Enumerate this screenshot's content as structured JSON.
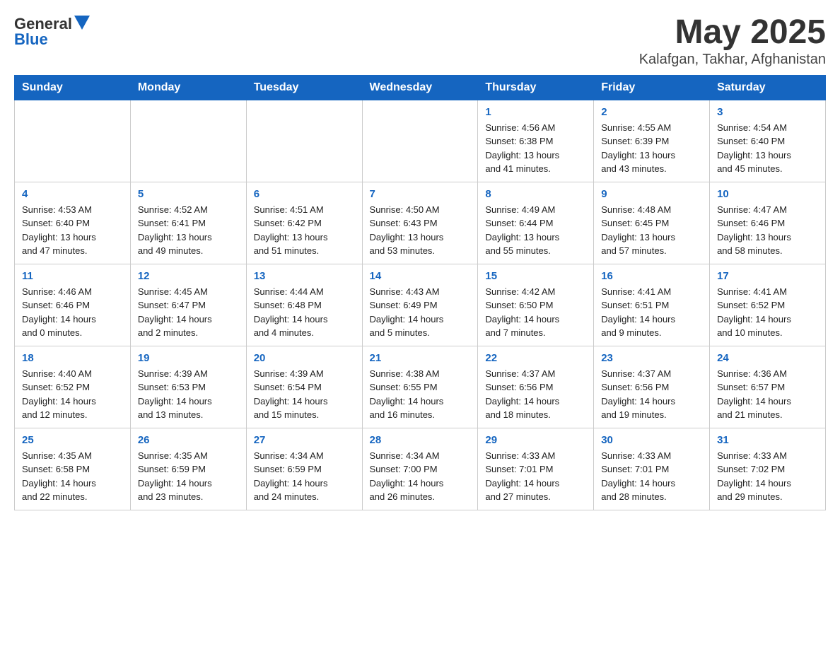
{
  "header": {
    "logo_general": "General",
    "logo_blue": "Blue",
    "month_year": "May 2025",
    "location": "Kalafgan, Takhar, Afghanistan"
  },
  "weekdays": [
    "Sunday",
    "Monday",
    "Tuesday",
    "Wednesday",
    "Thursday",
    "Friday",
    "Saturday"
  ],
  "weeks": [
    [
      {
        "day": "",
        "info": ""
      },
      {
        "day": "",
        "info": ""
      },
      {
        "day": "",
        "info": ""
      },
      {
        "day": "",
        "info": ""
      },
      {
        "day": "1",
        "info": "Sunrise: 4:56 AM\nSunset: 6:38 PM\nDaylight: 13 hours\nand 41 minutes."
      },
      {
        "day": "2",
        "info": "Sunrise: 4:55 AM\nSunset: 6:39 PM\nDaylight: 13 hours\nand 43 minutes."
      },
      {
        "day": "3",
        "info": "Sunrise: 4:54 AM\nSunset: 6:40 PM\nDaylight: 13 hours\nand 45 minutes."
      }
    ],
    [
      {
        "day": "4",
        "info": "Sunrise: 4:53 AM\nSunset: 6:40 PM\nDaylight: 13 hours\nand 47 minutes."
      },
      {
        "day": "5",
        "info": "Sunrise: 4:52 AM\nSunset: 6:41 PM\nDaylight: 13 hours\nand 49 minutes."
      },
      {
        "day": "6",
        "info": "Sunrise: 4:51 AM\nSunset: 6:42 PM\nDaylight: 13 hours\nand 51 minutes."
      },
      {
        "day": "7",
        "info": "Sunrise: 4:50 AM\nSunset: 6:43 PM\nDaylight: 13 hours\nand 53 minutes."
      },
      {
        "day": "8",
        "info": "Sunrise: 4:49 AM\nSunset: 6:44 PM\nDaylight: 13 hours\nand 55 minutes."
      },
      {
        "day": "9",
        "info": "Sunrise: 4:48 AM\nSunset: 6:45 PM\nDaylight: 13 hours\nand 57 minutes."
      },
      {
        "day": "10",
        "info": "Sunrise: 4:47 AM\nSunset: 6:46 PM\nDaylight: 13 hours\nand 58 minutes."
      }
    ],
    [
      {
        "day": "11",
        "info": "Sunrise: 4:46 AM\nSunset: 6:46 PM\nDaylight: 14 hours\nand 0 minutes."
      },
      {
        "day": "12",
        "info": "Sunrise: 4:45 AM\nSunset: 6:47 PM\nDaylight: 14 hours\nand 2 minutes."
      },
      {
        "day": "13",
        "info": "Sunrise: 4:44 AM\nSunset: 6:48 PM\nDaylight: 14 hours\nand 4 minutes."
      },
      {
        "day": "14",
        "info": "Sunrise: 4:43 AM\nSunset: 6:49 PM\nDaylight: 14 hours\nand 5 minutes."
      },
      {
        "day": "15",
        "info": "Sunrise: 4:42 AM\nSunset: 6:50 PM\nDaylight: 14 hours\nand 7 minutes."
      },
      {
        "day": "16",
        "info": "Sunrise: 4:41 AM\nSunset: 6:51 PM\nDaylight: 14 hours\nand 9 minutes."
      },
      {
        "day": "17",
        "info": "Sunrise: 4:41 AM\nSunset: 6:52 PM\nDaylight: 14 hours\nand 10 minutes."
      }
    ],
    [
      {
        "day": "18",
        "info": "Sunrise: 4:40 AM\nSunset: 6:52 PM\nDaylight: 14 hours\nand 12 minutes."
      },
      {
        "day": "19",
        "info": "Sunrise: 4:39 AM\nSunset: 6:53 PM\nDaylight: 14 hours\nand 13 minutes."
      },
      {
        "day": "20",
        "info": "Sunrise: 4:39 AM\nSunset: 6:54 PM\nDaylight: 14 hours\nand 15 minutes."
      },
      {
        "day": "21",
        "info": "Sunrise: 4:38 AM\nSunset: 6:55 PM\nDaylight: 14 hours\nand 16 minutes."
      },
      {
        "day": "22",
        "info": "Sunrise: 4:37 AM\nSunset: 6:56 PM\nDaylight: 14 hours\nand 18 minutes."
      },
      {
        "day": "23",
        "info": "Sunrise: 4:37 AM\nSunset: 6:56 PM\nDaylight: 14 hours\nand 19 minutes."
      },
      {
        "day": "24",
        "info": "Sunrise: 4:36 AM\nSunset: 6:57 PM\nDaylight: 14 hours\nand 21 minutes."
      }
    ],
    [
      {
        "day": "25",
        "info": "Sunrise: 4:35 AM\nSunset: 6:58 PM\nDaylight: 14 hours\nand 22 minutes."
      },
      {
        "day": "26",
        "info": "Sunrise: 4:35 AM\nSunset: 6:59 PM\nDaylight: 14 hours\nand 23 minutes."
      },
      {
        "day": "27",
        "info": "Sunrise: 4:34 AM\nSunset: 6:59 PM\nDaylight: 14 hours\nand 24 minutes."
      },
      {
        "day": "28",
        "info": "Sunrise: 4:34 AM\nSunset: 7:00 PM\nDaylight: 14 hours\nand 26 minutes."
      },
      {
        "day": "29",
        "info": "Sunrise: 4:33 AM\nSunset: 7:01 PM\nDaylight: 14 hours\nand 27 minutes."
      },
      {
        "day": "30",
        "info": "Sunrise: 4:33 AM\nSunset: 7:01 PM\nDaylight: 14 hours\nand 28 minutes."
      },
      {
        "day": "31",
        "info": "Sunrise: 4:33 AM\nSunset: 7:02 PM\nDaylight: 14 hours\nand 29 minutes."
      }
    ]
  ]
}
